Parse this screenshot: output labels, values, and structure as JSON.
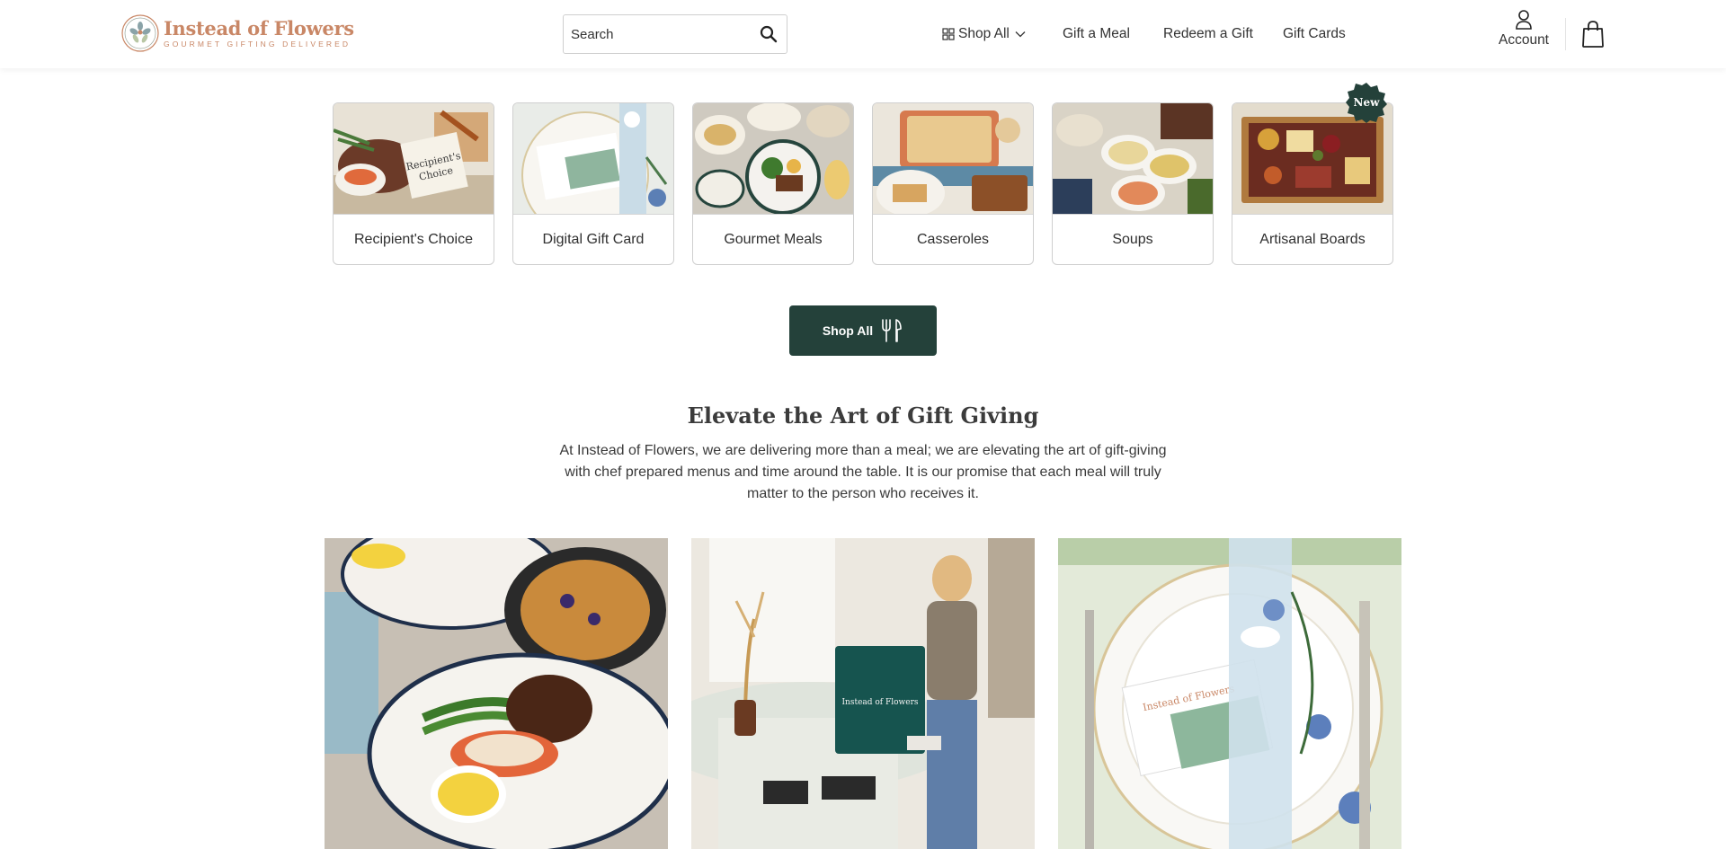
{
  "header": {
    "logo": {
      "name": "Instead of Flowers",
      "tagline": "GOURMET GIFTING DELIVERED"
    },
    "search": {
      "placeholder": "Search"
    },
    "nav": {
      "shop_all": "Shop All",
      "gift_meal": "Gift a Meal",
      "redeem_gift": "Redeem a Gift",
      "gift_cards": "Gift Cards"
    },
    "account_label": "Account"
  },
  "categories": [
    {
      "label": "Recipient's Choice",
      "image": "recipients-choice-photo"
    },
    {
      "label": "Digital Gift Card",
      "image": "digital-gift-card-photo"
    },
    {
      "label": "Gourmet Meals",
      "image": "gourmet-meals-photo"
    },
    {
      "label": "Casseroles",
      "image": "casseroles-photo"
    },
    {
      "label": "Soups",
      "image": "soups-photo"
    },
    {
      "label": "Artisanal Boards",
      "image": "artisanal-boards-photo",
      "badge": "New"
    }
  ],
  "cta": {
    "label": "Shop All",
    "icon": "fork-knife-icon"
  },
  "intro": {
    "heading": "Elevate the Art of Gift Giving",
    "body_line1": "At Instead of Flowers, we are delivering more than a meal; we are elevating the art of gift-giving",
    "body_line2": "with chef prepared menus and time around the table. It is our promise that each meal will truly",
    "body_line3": "matter to the person who receives it."
  },
  "colors": {
    "brand_green": "#24413a",
    "brand_peach": "#c98766",
    "text": "#2f2f2f"
  }
}
